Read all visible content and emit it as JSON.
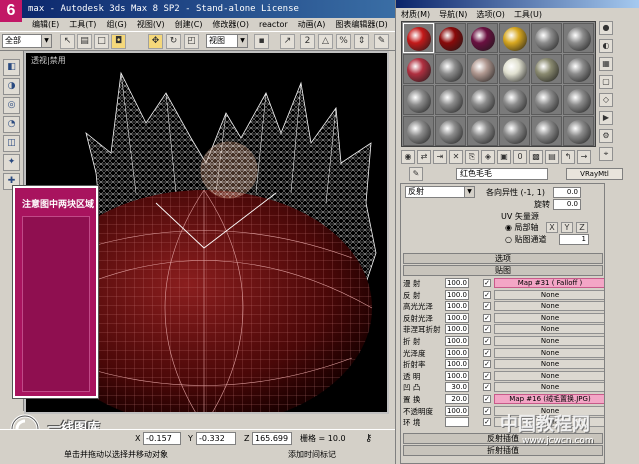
{
  "badge": "6",
  "title": "max - Autodesk 3ds Max 8 SP2 - Stand-alone License",
  "menu": [
    "编辑(E)",
    "工具(T)",
    "组(G)",
    "视图(V)",
    "创建(C)",
    "修改器(O)",
    "reactor",
    "动画(A)",
    "图表编辑器(D)"
  ],
  "toolbar": {
    "selection_filter": "全部",
    "ref_coord": "视图"
  },
  "viewport": {
    "label": "透视|禁用"
  },
  "note_card": {
    "text": "注意图中两块区域"
  },
  "watermark_left": "一线图库",
  "watermark_right": {
    "cn": "中国教程网",
    "url": "www.jcwcn.com"
  },
  "status": {
    "x_label": "X",
    "x_value": "-0.157",
    "y_label": "Y",
    "y_value": "-0.332",
    "z_label": "Z",
    "z_value": "165.699",
    "grid_label": "栅格 = 10.0",
    "hint": "单击并拖动以选择并移动对象",
    "hint2": "添加时间标记"
  },
  "mat_editor": {
    "menu": [
      "材质(M)",
      "导航(N)",
      "选项(O)",
      "工具(U)"
    ],
    "slots": [
      {
        "color": "#c41a1a",
        "ring": "#fff"
      },
      {
        "color": "#8a0a0a",
        "ring": "#000"
      },
      {
        "color": "#6a1040",
        "ring": "#000"
      },
      {
        "color": "#d8a820",
        "ring": "#000"
      },
      {
        "color": "#8c8c8c",
        "ring": "#000"
      },
      {
        "color": "#8c8c8c",
        "ring": "#000"
      },
      {
        "color": "#b03040",
        "ring": "#000"
      },
      {
        "color": "#8c8c8c",
        "ring": "#000"
      },
      {
        "color": "#b09890",
        "ring": "#000"
      },
      {
        "color": "#e0e0d0",
        "ring": "#000"
      },
      {
        "color": "#8a8a70",
        "ring": "#000"
      },
      {
        "color": "#8c8c8c",
        "ring": "#000"
      }
    ],
    "mat_name": "红色毛毛",
    "mat_type": "VRayMtl",
    "reflect_select": "反射",
    "aniso_label": "各向异性 (-1, 1)",
    "aniso_value": "0.0",
    "rotation_label": "旋转",
    "rotation_value": "0.0",
    "uv_label": "UV 矢量源",
    "local_axis": "局部轴",
    "map_channel": "贴图通道",
    "map_channel_value": "1",
    "x": "X",
    "y": "Y",
    "z": "Z",
    "rollout_options": "选项",
    "rollout_maps": "贴图",
    "maps": [
      {
        "label": "漫 射",
        "amount": "100.0",
        "map": "Map #31  ( Falloff )",
        "pink": true
      },
      {
        "label": "反 射",
        "amount": "100.0",
        "map": "None",
        "pink": false
      },
      {
        "label": "高光光泽",
        "amount": "100.0",
        "map": "None",
        "pink": false
      },
      {
        "label": "反射光泽",
        "amount": "100.0",
        "map": "None",
        "pink": false
      },
      {
        "label": "菲涅耳折射",
        "amount": "100.0",
        "map": "None",
        "pink": false
      },
      {
        "label": "折 射",
        "amount": "100.0",
        "map": "None",
        "pink": false
      },
      {
        "label": "光泽度",
        "amount": "100.0",
        "map": "None",
        "pink": false
      },
      {
        "label": "折射率",
        "amount": "100.0",
        "map": "None",
        "pink": false
      },
      {
        "label": "透 明",
        "amount": "100.0",
        "map": "None",
        "pink": false
      },
      {
        "label": "凹 凸",
        "amount": "30.0",
        "map": "None",
        "pink": false
      },
      {
        "label": "置 换",
        "amount": "20.0",
        "map": "Map #16 (绒毛置换.JPG)",
        "pink": true
      },
      {
        "label": "不透明度",
        "amount": "100.0",
        "map": "None",
        "pink": false
      },
      {
        "label": "环 境",
        "amount": "",
        "map": "None",
        "pink": false
      }
    ],
    "rollout_reflect_interp": "反射插值",
    "rollout_refract_interp": "折射插值"
  }
}
